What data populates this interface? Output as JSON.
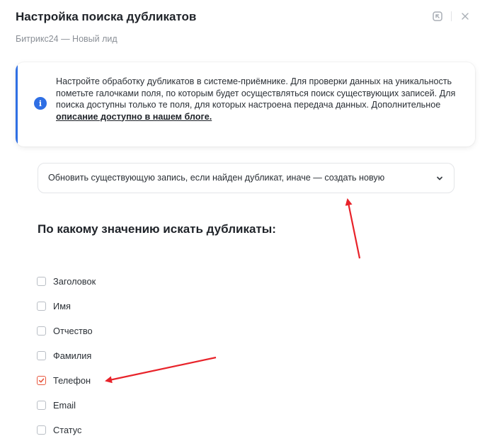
{
  "header": {
    "title": "Настройка поиска дубликатов",
    "subtitle": "Битрикс24 — Новый лид",
    "actions": [
      {
        "icon": "collapse-icon"
      },
      {
        "icon": "close-icon"
      }
    ]
  },
  "info": {
    "icon": "info-icon",
    "text": "Настройте обработку дубликатов в системе-приёмнике. Для проверки данных на уникальность пометьте галочками поля, по которым будет осуществляться поиск существующих записей. Для поиска доступны только те поля, для которых настроена передача данных. Дополнительное ",
    "link": "описание доступно в нашем блоге.",
    "accent_color": "#2f6fe4"
  },
  "mode_select": {
    "value": "Обновить существующую запись, если найден дубликат, иначе — создать новую",
    "icon": "chevron-down-icon"
  },
  "section_title": "По какому значению искать дубликаты:",
  "fields": [
    {
      "label": "Заголовок",
      "checked": false
    },
    {
      "label": "Имя",
      "checked": false
    },
    {
      "label": "Отчество",
      "checked": false
    },
    {
      "label": "Фамилия",
      "checked": false
    },
    {
      "label": "Телефон",
      "checked": true
    },
    {
      "label": "Email",
      "checked": false
    },
    {
      "label": "Статус",
      "checked": false
    }
  ],
  "annotation_color": "#e8232a"
}
